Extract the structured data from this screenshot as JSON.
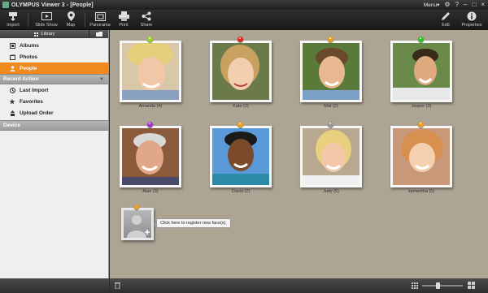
{
  "window": {
    "title": "OLYMPUS Viewer 3 - [People]",
    "menu_label": "Menu▾"
  },
  "toolbar": {
    "items": [
      {
        "label": "Import",
        "icon": "import-icon"
      },
      {
        "label": "Slide Show",
        "icon": "slideshow-icon"
      },
      {
        "label": "Map",
        "icon": "map-pin-icon"
      },
      {
        "label": "Panorama",
        "icon": "panorama-icon"
      },
      {
        "label": "Print",
        "icon": "printer-icon"
      },
      {
        "label": "Share",
        "icon": "share-icon"
      },
      {
        "label": "Edit",
        "icon": "pencil-icon"
      },
      {
        "label": "Properties",
        "icon": "info-icon"
      }
    ]
  },
  "sidebar": {
    "library_tab": "Library",
    "library_items": [
      {
        "label": "Albums",
        "icon": "album-icon",
        "selected": false
      },
      {
        "label": "Photos",
        "icon": "photos-icon",
        "selected": false
      },
      {
        "label": "People",
        "icon": "person-icon",
        "selected": true
      }
    ],
    "recent_section": "Recent Action",
    "recent_items": [
      {
        "label": "Last Import",
        "icon": "history-icon"
      },
      {
        "label": "Favorites",
        "icon": "star-icon"
      },
      {
        "label": "Upload Order",
        "icon": "upload-icon"
      }
    ],
    "device_section": "Device"
  },
  "people": [
    {
      "name": "Amanda (4)",
      "pin_color": "#9bd321"
    },
    {
      "name": "Kate (2)",
      "pin_color": "#e02626"
    },
    {
      "name": "Mat (2)",
      "pin_color": "#f0a020"
    },
    {
      "name": "Jesper (3)",
      "pin_color": "#2fc22f"
    },
    {
      "name": "Alan (3)",
      "pin_color": "#a534d8"
    },
    {
      "name": "David (2)",
      "pin_color": "#f0a020"
    },
    {
      "name": "Judy (5)",
      "pin_color": "#9a9a9a"
    },
    {
      "name": "samantha (5)",
      "pin_color": "#f0a020"
    }
  ],
  "register": {
    "tooltip": "Click here to register new face(s)."
  },
  "colors": {
    "accent": "#f08a1c",
    "background": "#ada494"
  }
}
